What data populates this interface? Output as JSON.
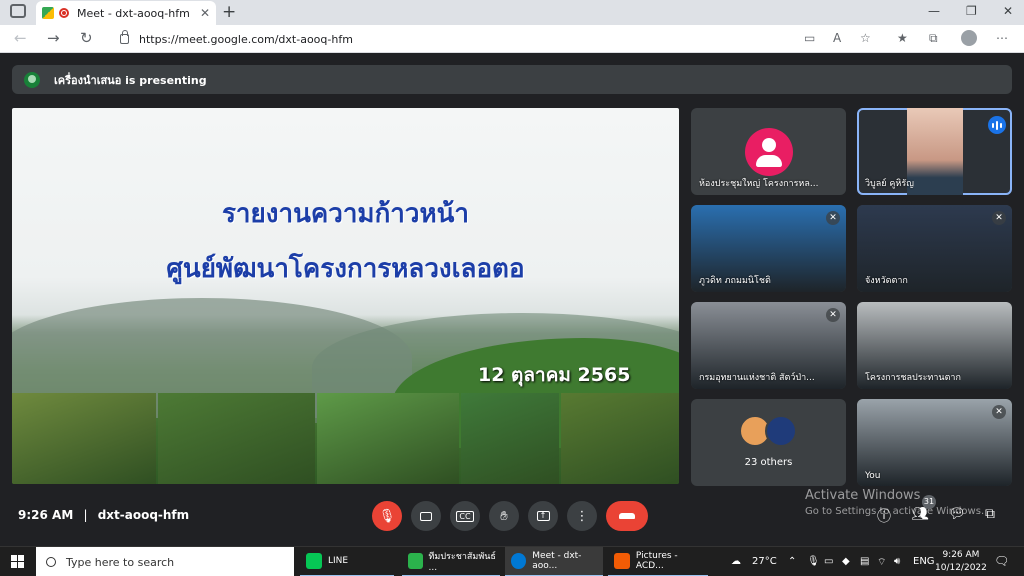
{
  "browser": {
    "tab_title": "Meet - dxt-aooq-hfm",
    "tab_close": "✕",
    "new_tab": "+",
    "url": "https://meet.google.com/dxt-aooq-hfm",
    "window_controls": [
      "—",
      "❐",
      "✕"
    ]
  },
  "meet": {
    "presenting_text": "เครื่องนำเสนอ is presenting",
    "slide": {
      "title_line1": "รายงานความก้าวหน้า",
      "title_line2": "ศูนย์พัฒนาโครงการหลวงเลอตอ",
      "date": "12 ตุลาคม  2565",
      "photo_colors": [
        "#6f8a3e",
        "#4d7a35",
        "#5e9a48",
        "#3f7a3a",
        "#587a32"
      ]
    },
    "tiles": [
      {
        "name": "ห้องประชุมใหญ่ โครงการหล...",
        "muted": false,
        "kind": "avatar"
      },
      {
        "name": "วิบูลย์ คูหิรัญ",
        "muted": false,
        "kind": "speaking"
      },
      {
        "name": "ภูวดิท ภถมมนิโชติ",
        "muted": true,
        "kind": "video",
        "color": "#2a6fb0"
      },
      {
        "name": "จังหวัดตาก",
        "muted": true,
        "kind": "video",
        "color": "#2d3a4f"
      },
      {
        "name": "กรมอุทยานแห่งชาติ สัตว์ป่า...",
        "muted": true,
        "kind": "video",
        "color": "#8a8f96"
      },
      {
        "name": "โครงการชลประทานตาก",
        "muted": false,
        "kind": "video",
        "color": "#b9bdbf"
      },
      {
        "name": "23 others",
        "kind": "others"
      },
      {
        "name": "You",
        "muted": true,
        "kind": "video",
        "color": "#9aa3aa"
      }
    ],
    "time": "9:26 AM",
    "separator": "|",
    "meeting_code": "dxt-aooq-hfm",
    "participant_count": "31",
    "watermark_title": "Activate Windows",
    "watermark_sub": "Go to Settings to activate Windows."
  },
  "taskbar": {
    "search_placeholder": "Type here to search",
    "apps": [
      {
        "label": "LINE",
        "color": "#06c755"
      },
      {
        "label": "ทีมประชาสัมพันธ์ ...",
        "color": "#2bb24c"
      },
      {
        "label": "Meet - dxt-aoo...",
        "color": "#0078d4"
      },
      {
        "label": "Pictures - ACD...",
        "color": "#f25c05"
      }
    ],
    "weather": "27°C",
    "lang": "ENG",
    "clock_time": "9:26 AM",
    "clock_date": "10/12/2022"
  },
  "colors": {
    "accent": "#1a73e8",
    "danger": "#ea4335",
    "surface": "#3c4043",
    "background": "#202124"
  }
}
